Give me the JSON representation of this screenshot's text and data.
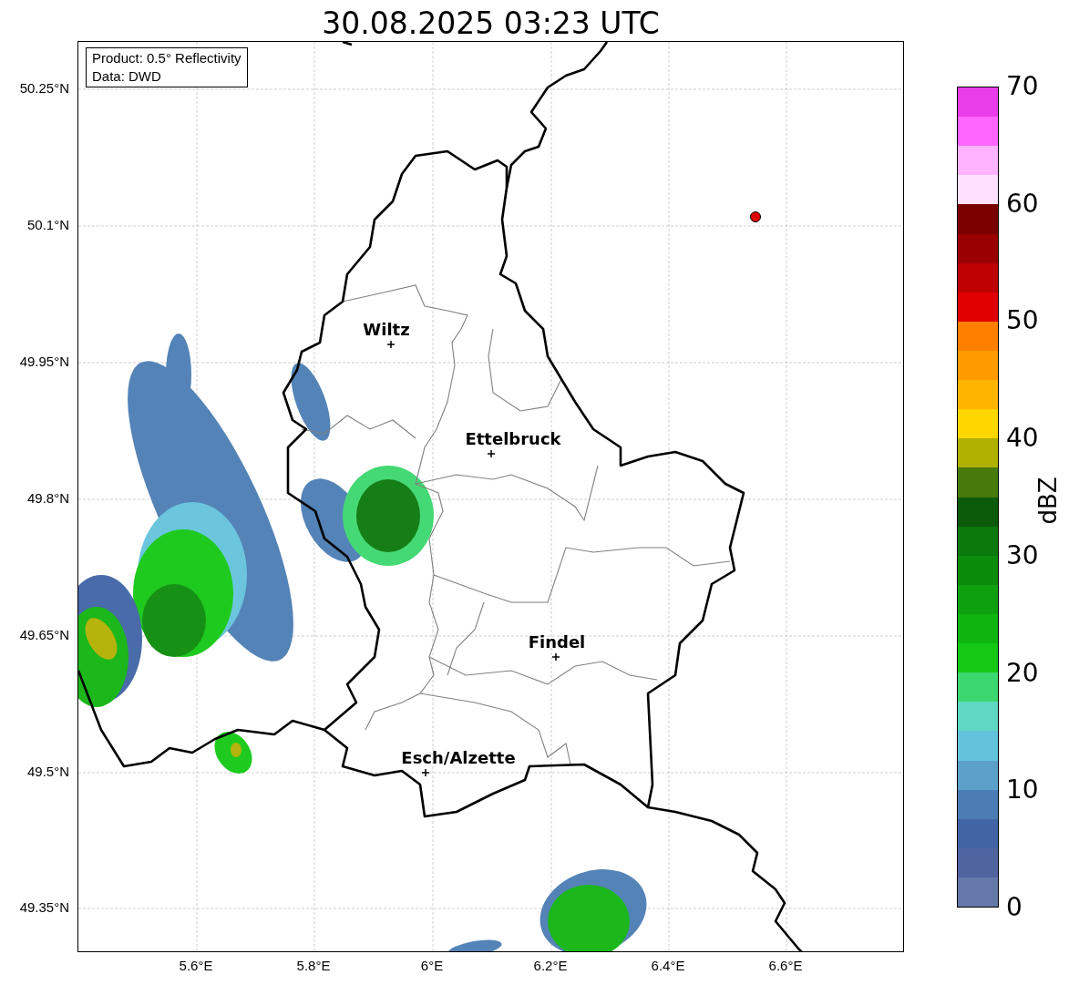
{
  "title": "30.08.2025 03:23 UTC",
  "info_box": [
    "Product: 0.5° Reflectivity",
    "Data: DWD"
  ],
  "lat_ticks": [
    "50.25°N",
    "50.1°N",
    "49.95°N",
    "49.8°N",
    "49.65°N",
    "49.5°N",
    "49.35°N"
  ],
  "lon_ticks": [
    "5.6°E",
    "5.8°E",
    "6°E",
    "6.2°E",
    "6.4°E",
    "6.6°E"
  ],
  "cities": [
    {
      "name": "Wiltz"
    },
    {
      "name": "Ettelbruck"
    },
    {
      "name": "Findel"
    },
    {
      "name": "Esch/Alzette"
    }
  ],
  "colorbar": {
    "label": "dBZ",
    "ticks": [
      "70",
      "60",
      "50",
      "40",
      "30",
      "20",
      "10",
      "0"
    ],
    "bins": [
      {
        "color": "#e93de9"
      },
      {
        "color": "#ff66ff"
      },
      {
        "color": "#ffb3ff"
      },
      {
        "color": "#ffe0ff"
      },
      {
        "color": "#7a0000"
      },
      {
        "color": "#9a0000"
      },
      {
        "color": "#be0000"
      },
      {
        "color": "#e00000"
      },
      {
        "color": "#ff7f00"
      },
      {
        "color": "#ff9a00"
      },
      {
        "color": "#ffb400"
      },
      {
        "color": "#ffd700"
      },
      {
        "color": "#b0b000"
      },
      {
        "color": "#467a0a"
      },
      {
        "color": "#0a5a0a"
      },
      {
        "color": "#0a780a"
      },
      {
        "color": "#0a8c0a"
      },
      {
        "color": "#0fa00f"
      },
      {
        "color": "#0fb40f"
      },
      {
        "color": "#14c814"
      },
      {
        "color": "#3cd76e"
      },
      {
        "color": "#5ed7c3"
      },
      {
        "color": "#64c3dc"
      },
      {
        "color": "#5aa0c8"
      },
      {
        "color": "#4b7db4"
      },
      {
        "color": "#4164a5"
      },
      {
        "color": "#5064a0"
      },
      {
        "color": "#6478aa"
      }
    ]
  }
}
